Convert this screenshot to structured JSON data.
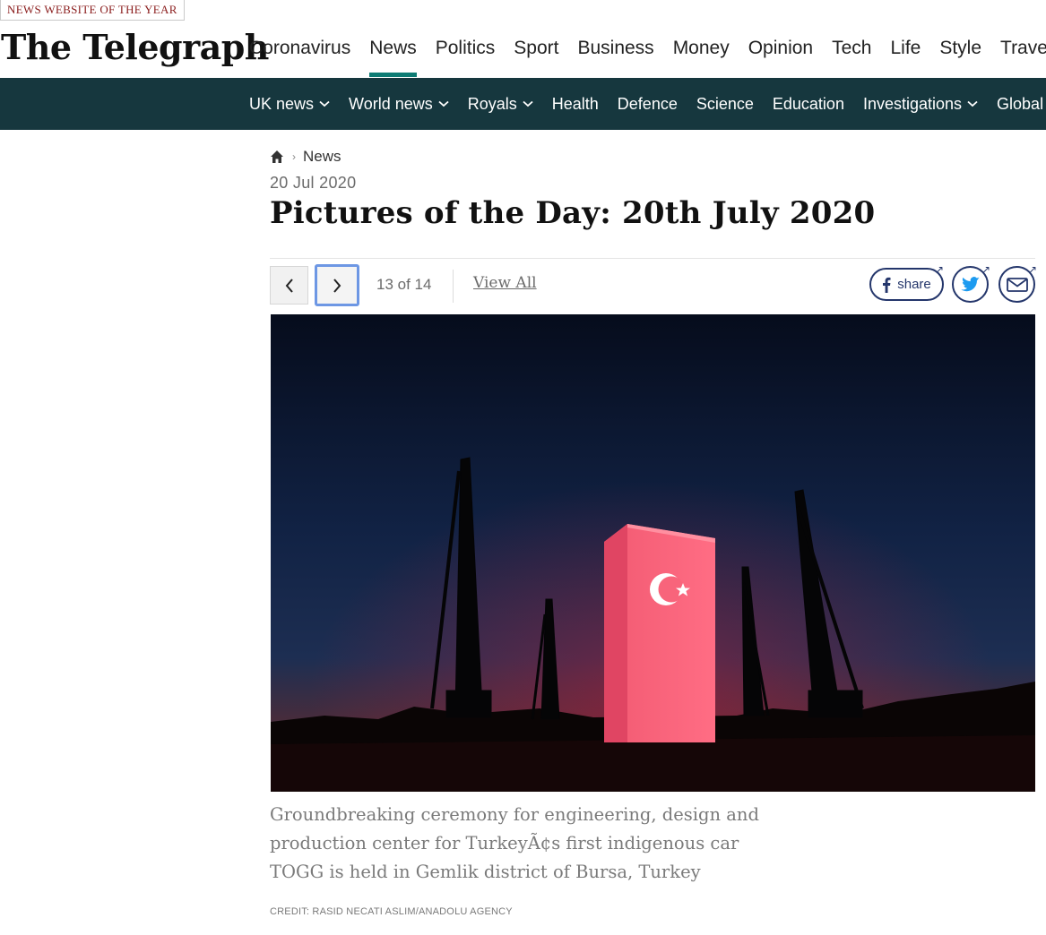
{
  "masthead": {
    "award": "NEWS WEBSITE OF THE YEAR",
    "logo": "The Telegraph"
  },
  "main_nav": {
    "items": [
      {
        "label": "Coronavirus"
      },
      {
        "label": "News"
      },
      {
        "label": "Politics"
      },
      {
        "label": "Sport"
      },
      {
        "label": "Business"
      },
      {
        "label": "Money"
      },
      {
        "label": "Opinion"
      },
      {
        "label": "Tech"
      },
      {
        "label": "Life"
      },
      {
        "label": "Style"
      },
      {
        "label": "Travel"
      }
    ],
    "active": "News",
    "accent": "#0e7c74"
  },
  "sub_nav": {
    "background": "#16373e",
    "items": [
      {
        "label": "UK news",
        "dropdown": true
      },
      {
        "label": "World news",
        "dropdown": true
      },
      {
        "label": "Royals",
        "dropdown": true
      },
      {
        "label": "Health",
        "dropdown": false
      },
      {
        "label": "Defence",
        "dropdown": false
      },
      {
        "label": "Science",
        "dropdown": false
      },
      {
        "label": "Education",
        "dropdown": false
      },
      {
        "label": "Investigations",
        "dropdown": true
      },
      {
        "label": "Global Health Security",
        "dropdown": false
      }
    ]
  },
  "breadcrumb": {
    "home_icon": "home-icon",
    "section": "News"
  },
  "article": {
    "date": "20 Jul 2020",
    "title": "Pictures of the Day: 20th July 2020"
  },
  "gallery": {
    "counter": "13 of 14",
    "view_all": "View All",
    "prev_icon": "chevron-left-icon",
    "next_icon": "chevron-right-icon"
  },
  "share": {
    "facebook_label": "share",
    "facebook_icon": "facebook-icon",
    "twitter_icon": "twitter-icon",
    "email_icon": "email-icon",
    "color": "#24366b"
  },
  "photo": {
    "caption": "Groundbreaking ceremony for engineering, design and production center for TurkeyÃ¢s first indigenous car TOGG is held in Gemlik district of Bursa, Turkey",
    "credit": "CREDIT: RASID NECATI ASLIM/ANADOLU AGENCY"
  }
}
